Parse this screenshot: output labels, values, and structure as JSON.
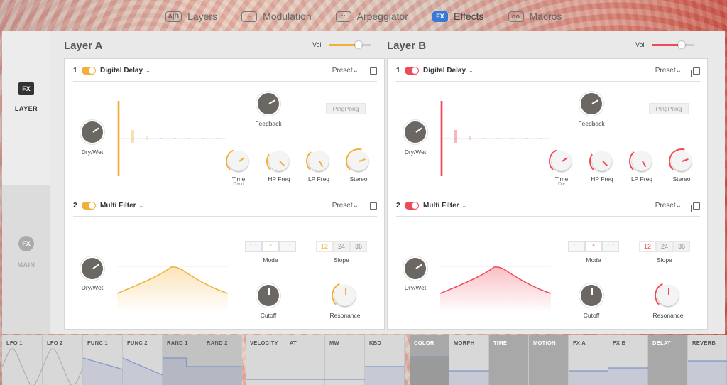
{
  "nav": {
    "items": [
      {
        "icon": "A|B",
        "label": "Layers"
      },
      {
        "icon": "~",
        "label": "Modulation"
      },
      {
        "icon": "::",
        "label": "Arpeggiator"
      },
      {
        "icon": "FX",
        "label": "Effects"
      },
      {
        "icon": "oo",
        "label": "Macros"
      }
    ],
    "active": "Effects"
  },
  "left": {
    "layer_icon": "FX",
    "layer_label": "LAYER",
    "main_icon": "FX",
    "main_label": "MAIN"
  },
  "layers": [
    {
      "title": "Layer A",
      "vol_label": "Vol",
      "vol": 0.7,
      "accent": "#f2b03a",
      "slot1": {
        "num": "1",
        "name": "Digital Delay",
        "preset": "Preset"
      },
      "delay": {
        "dry_wet": "Dry/Wet",
        "feedback": "Feedback",
        "pingpong": "PingPong",
        "time": "Time",
        "time_sub": "Div.d",
        "hp": "HP Freq",
        "lp": "LP Freq",
        "stereo": "Stereo"
      },
      "slot2": {
        "num": "2",
        "name": "Multi Filter",
        "preset": "Preset"
      },
      "filter": {
        "dry_wet": "Dry/Wet",
        "mode": "Mode",
        "slope": "Slope",
        "slopes": [
          "12",
          "24",
          "36"
        ],
        "cutoff": "Cutoff",
        "resonance": "Resonance"
      }
    },
    {
      "title": "Layer B",
      "vol_label": "Vol",
      "vol": 0.7,
      "accent": "#ef4a5a",
      "slot1": {
        "num": "1",
        "name": "Digital Delay",
        "preset": "Preset"
      },
      "delay": {
        "dry_wet": "Dry/Wet",
        "feedback": "Feedback",
        "pingpong": "PingPong",
        "time": "Time",
        "time_sub": "Div",
        "hp": "HP Freq",
        "lp": "LP Freq",
        "stereo": "Stereo"
      },
      "slot2": {
        "num": "2",
        "name": "Multi Filter",
        "preset": "Preset"
      },
      "filter": {
        "dry_wet": "Dry/Wet",
        "mode": "Mode",
        "slope": "Slope",
        "slopes": [
          "12",
          "24",
          "36"
        ],
        "cutoff": "Cutoff",
        "resonance": "Resonance"
      }
    }
  ],
  "mod_sources": [
    "LFO 1",
    "LFO 2",
    "FUNC 1",
    "FUNC 2",
    "RAND 1",
    "RAND 2",
    "VELOCITY",
    "AT",
    "MW",
    "KBD",
    "COLOR",
    "MORPH",
    "TIME",
    "MOTION",
    "FX A",
    "FX B",
    "DELAY",
    "REVERB"
  ]
}
